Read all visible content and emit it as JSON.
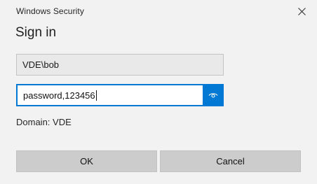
{
  "window": {
    "title": "Windows Security",
    "close_icon": "close-icon"
  },
  "heading": "Sign in",
  "username": {
    "value": "VDE\\bob"
  },
  "password": {
    "value": "password,123456",
    "reveal_icon": "eye-icon"
  },
  "domain": {
    "label": "Domain: VDE"
  },
  "buttons": {
    "ok": "OK",
    "cancel": "Cancel"
  },
  "colors": {
    "accent": "#0078d4",
    "background": "#f2f2f2",
    "button": "#cccccc"
  }
}
